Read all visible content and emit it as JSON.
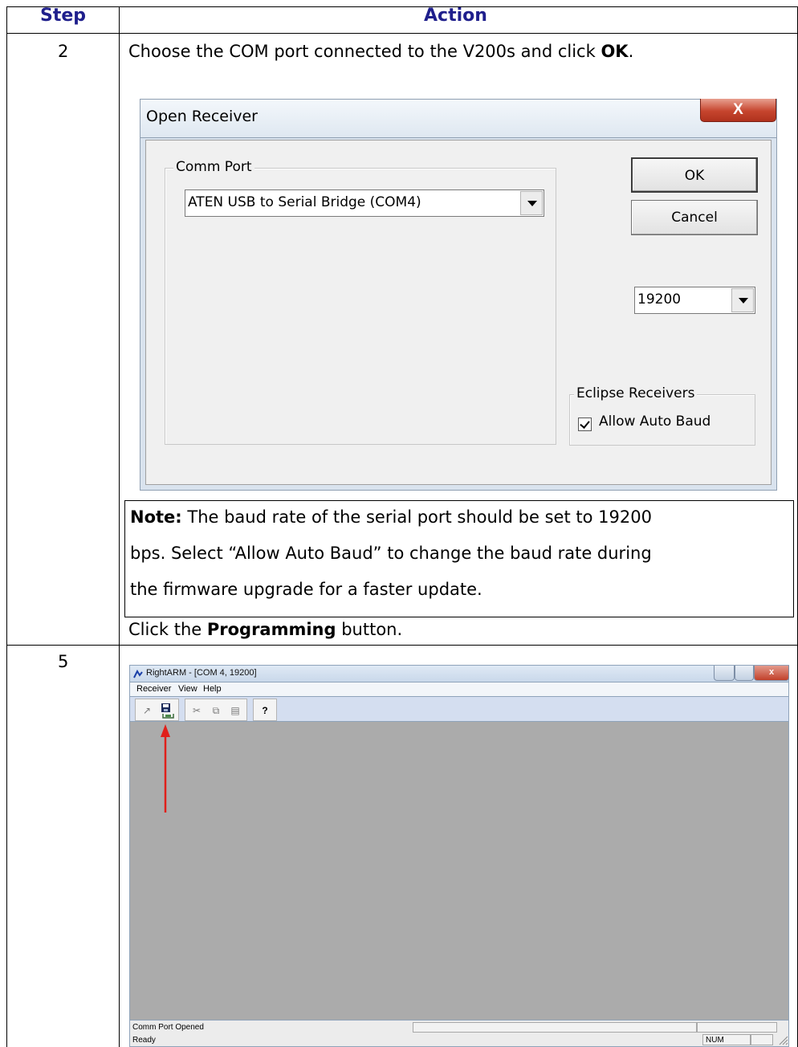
{
  "table": {
    "header_step": "Step",
    "header_action": "Action",
    "header_color": "#1f1f8c"
  },
  "row1": {
    "step": "2",
    "instruction_pre": "Choose the COM port connected to the V200s and click ",
    "instruction_bold": "OK",
    "instruction_post": "."
  },
  "dialog": {
    "title": "Open Receiver",
    "close_glyph": "X",
    "comm_port_group": "Comm Port",
    "comm_port_value": "ATEN USB to Serial Bridge (COM4)",
    "ok_label": "OK",
    "cancel_label": "Cancel",
    "baud_value": "19200",
    "eclipse_group": "Eclipse Receivers",
    "auto_baud_label": "Allow Auto Baud",
    "auto_baud_checked": true
  },
  "note": {
    "label": "Note:",
    "line1": " The baud rate of the serial port should be set to 19200",
    "line2": "bps. Select “Allow Auto Baud” to change the baud rate during",
    "line3": "the firmware upgrade for a faster update."
  },
  "row2": {
    "step": "5",
    "instruction_pre": "Click the ",
    "instruction_bold": "Programming",
    "instruction_post": " button."
  },
  "rightarm": {
    "title": "RightARM - [COM 4, 19200]",
    "menu": [
      "Receiver",
      "View",
      "Help"
    ],
    "toolbar_icons": [
      "connect-icon",
      "programming-icon",
      "cut-icon",
      "copy-icon",
      "paste-icon",
      "help-icon"
    ],
    "status_line1": "Comm Port Opened",
    "status_line2": "Ready",
    "num_indicator": "NUM",
    "arrow_color": "#e0201a",
    "client_color": "#ababab"
  }
}
